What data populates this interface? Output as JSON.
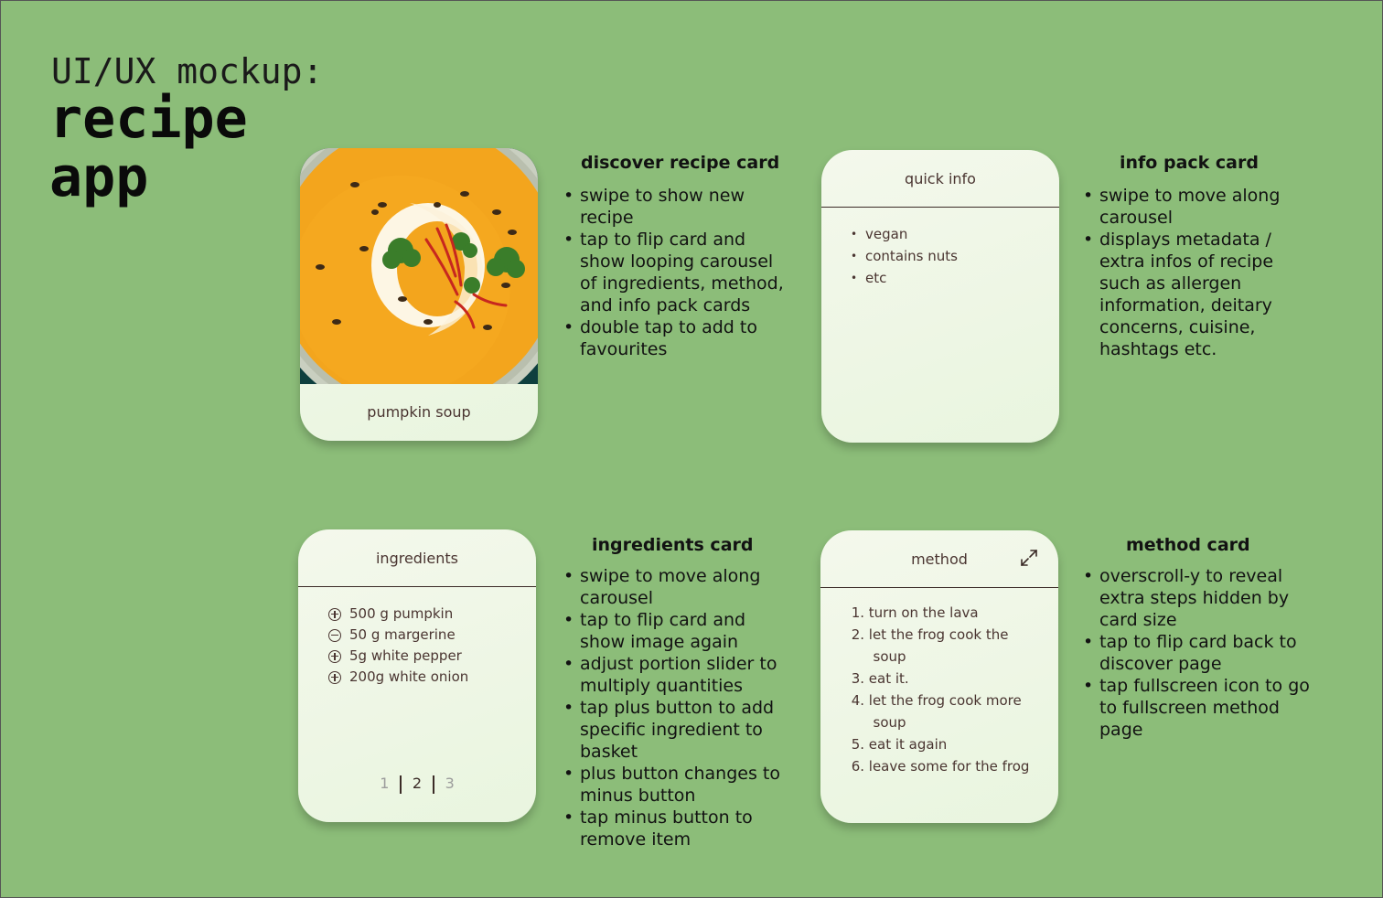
{
  "title": {
    "small": "UI/UX mockup:",
    "line1": "recipe",
    "line2": "app"
  },
  "discover_card": {
    "recipe_name": "pumpkin soup",
    "image": "pumpkin soup bowl photo"
  },
  "quick_info_card": {
    "header": "quick info",
    "items": [
      "vegan",
      "contains nuts",
      "etc"
    ]
  },
  "ingredients_card": {
    "header": "ingredients",
    "items": [
      {
        "label": "500 g pumpkin",
        "icon": "plus-circle-icon"
      },
      {
        "label": "50 g margerine",
        "icon": "minus-circle-icon"
      },
      {
        "label": "5g white pepper",
        "icon": "plus-circle-icon"
      },
      {
        "label": "200g white onion",
        "icon": "plus-circle-icon"
      }
    ],
    "pages": [
      "1",
      "2",
      "3"
    ],
    "active_page": "2"
  },
  "method_card": {
    "header": "method",
    "fullscreen_icon": "expand-icon",
    "steps": [
      {
        "num": "1.",
        "line1": "turn on the lava",
        "line2": ""
      },
      {
        "num": "2.",
        "line1": "let the frog cook the",
        "line2": "soup"
      },
      {
        "num": "3.",
        "line1": "eat it.",
        "line2": ""
      },
      {
        "num": "4.",
        "line1": "let the frog cook more",
        "line2": "soup"
      },
      {
        "num": "5.",
        "line1": "eat it again",
        "line2": ""
      },
      {
        "num": "6.",
        "line1": "leave some for the frog",
        "line2": ""
      }
    ]
  },
  "notes": {
    "discover": {
      "title": "discover recipe card",
      "items": [
        "swipe to show new recipe",
        "tap to flip card and show looping carousel of ingredients, method, and info pack cards",
        "double tap to add to favourites"
      ]
    },
    "info": {
      "title": "info pack card",
      "items": [
        "swipe to move along carousel",
        "displays metadata / extra infos of recipe such as allergen information, deitary concerns, cuisine, hashtags etc."
      ]
    },
    "ingredients": {
      "title": "ingredients card",
      "items": [
        "swipe to move along carousel",
        "tap to flip card and show image again",
        "adjust portion slider to multiply quantities",
        "tap plus button to add specific ingredient to basket"
      ],
      "subitems": [
        "plus button changes to minus button",
        "tap minus button to remove item"
      ]
    },
    "method": {
      "title": "method card",
      "items": [
        "overscroll-y to reveal extra steps hidden by card size",
        "tap to flip card back to discover page",
        "tap fullscreen icon to go to fullscreen method page"
      ]
    }
  },
  "colors": {
    "background": "#8cbd79",
    "card": "#eef6e6",
    "card_text": "#4a3531",
    "soup": "#f0a21c"
  }
}
